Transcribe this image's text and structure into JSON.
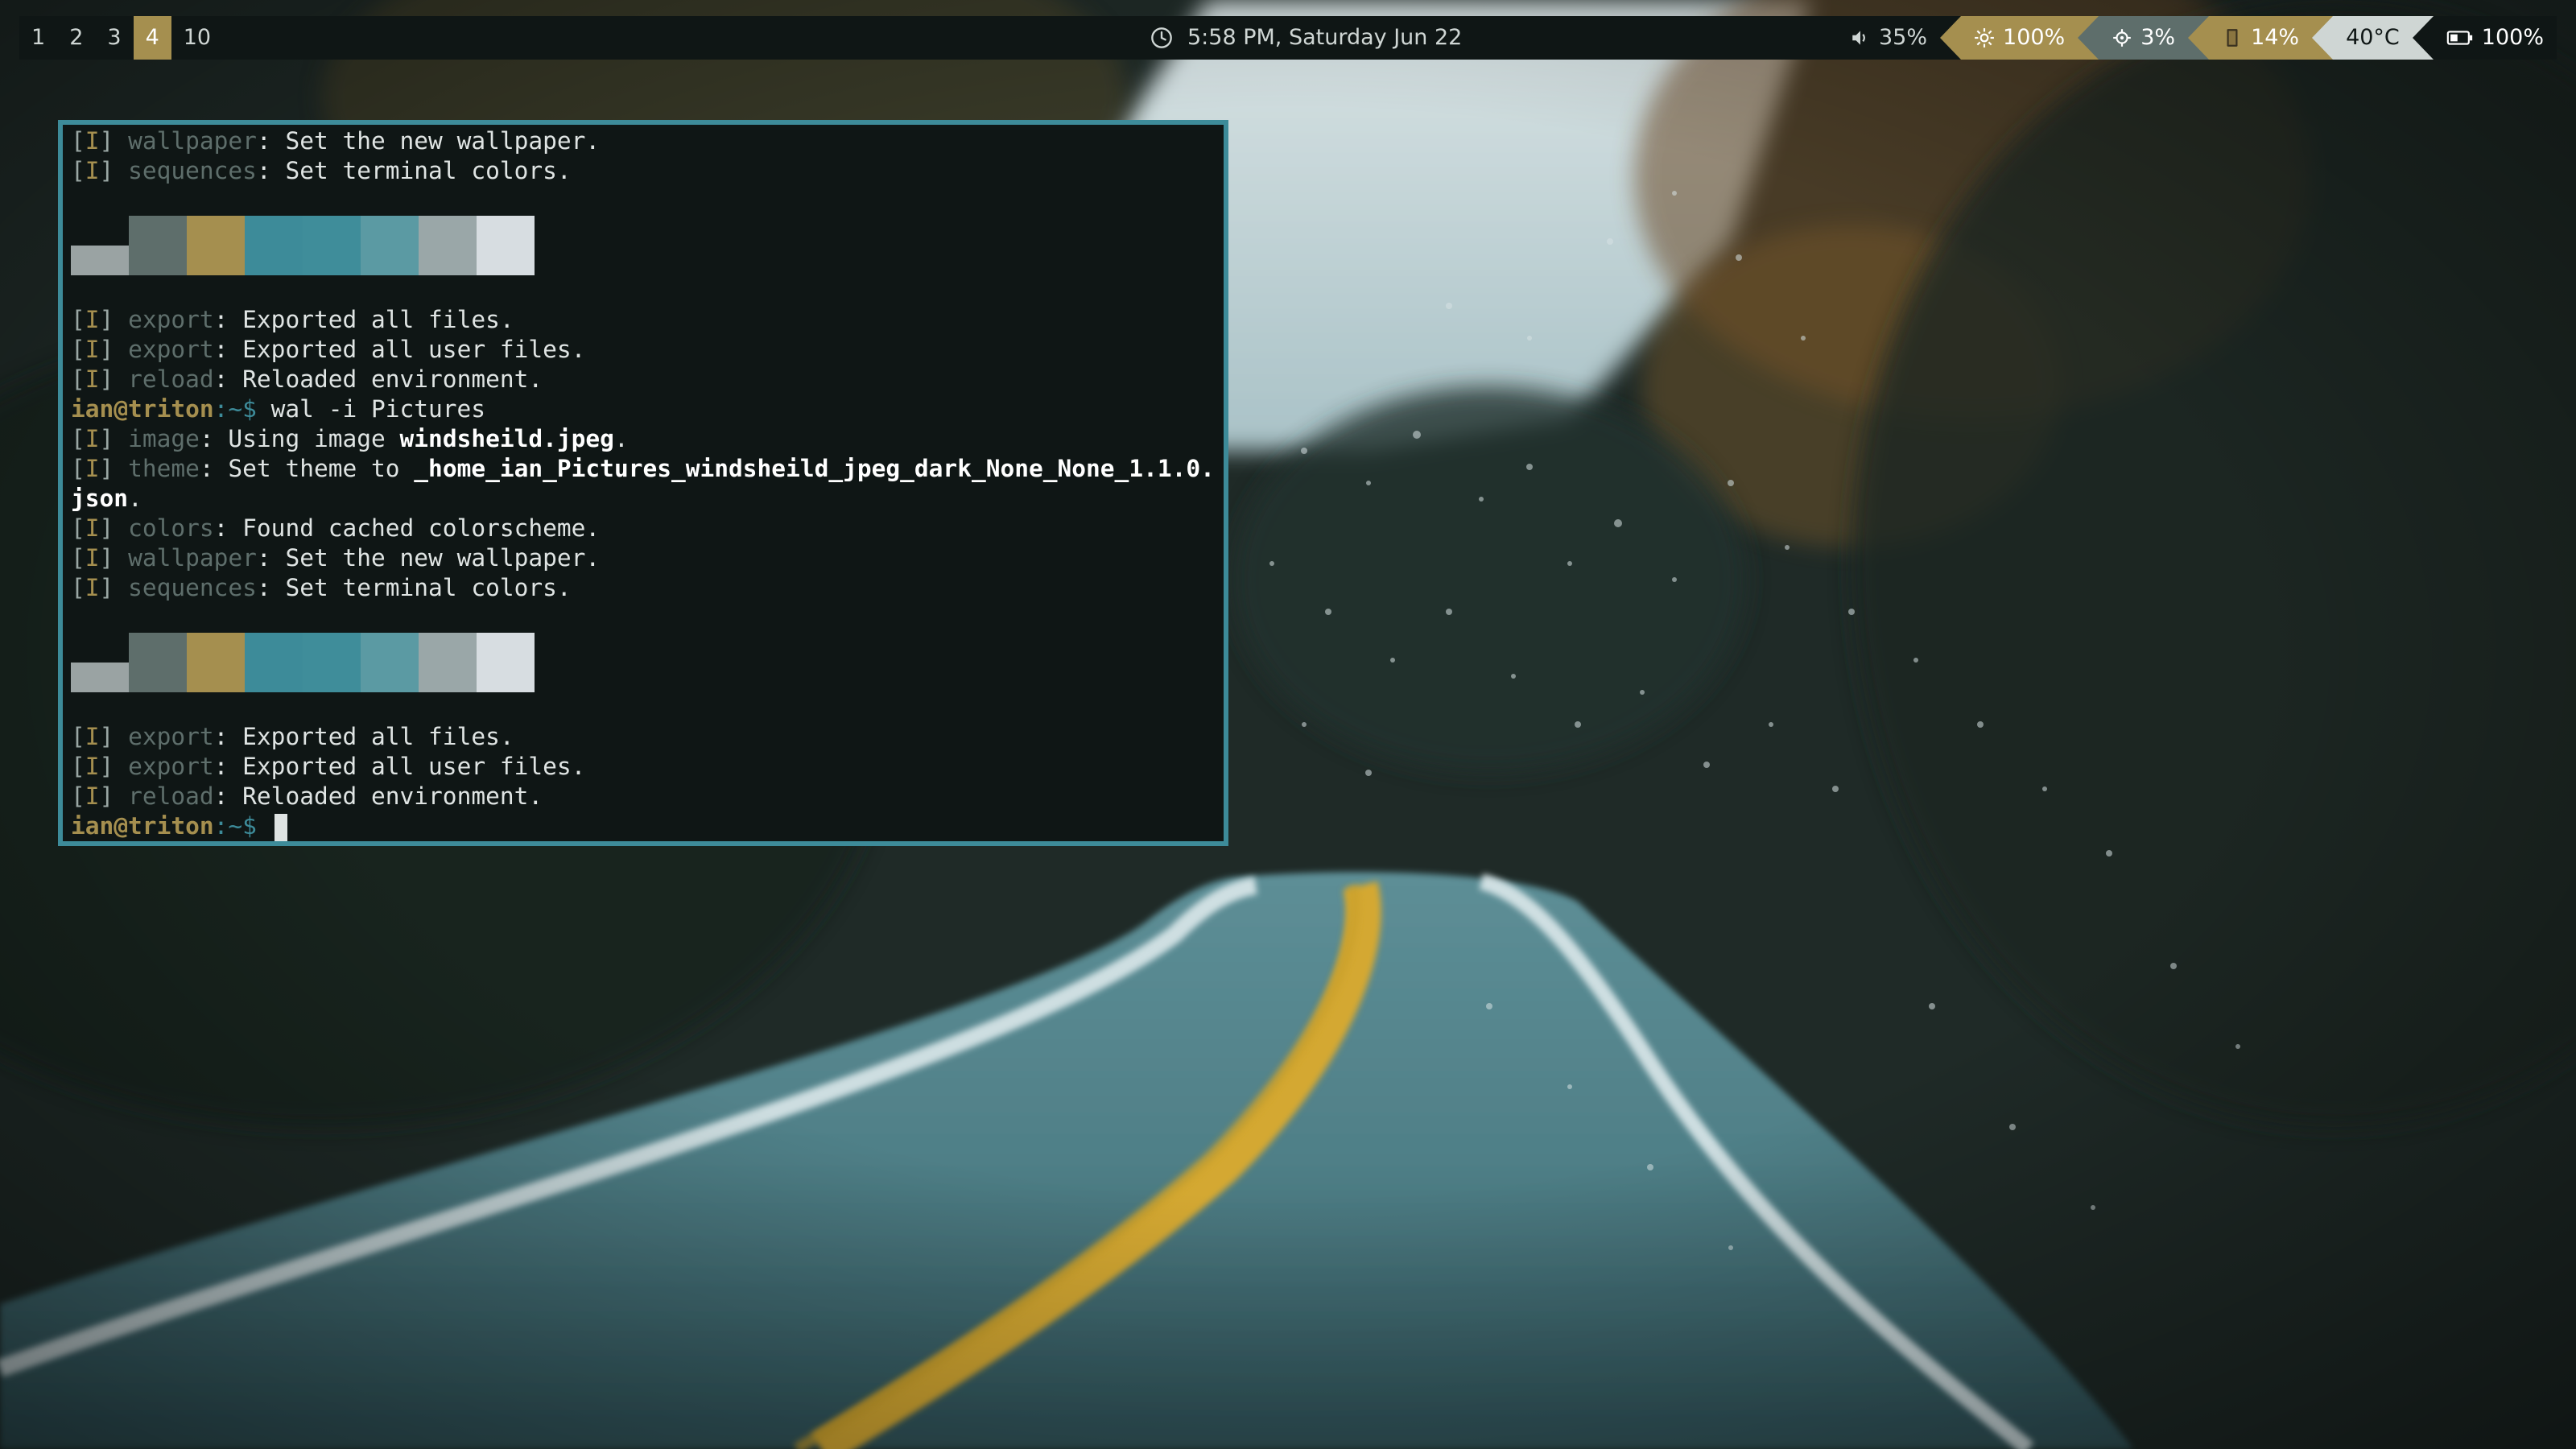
{
  "bar": {
    "workspaces": [
      {
        "label": "1",
        "active": false
      },
      {
        "label": "2",
        "active": false
      },
      {
        "label": "3",
        "active": false
      },
      {
        "label": "4",
        "active": true
      },
      {
        "label": "10",
        "active": false
      }
    ],
    "clock": "5:58 PM, Saturday Jun 22",
    "modules": {
      "volume": "35%",
      "brightness": "100%",
      "cpu": "3%",
      "memory": "14%",
      "temperature": "40°C",
      "battery": "100%"
    },
    "colors": {
      "bar_bg": "#0f1615",
      "accent_gold": "#a58f4f",
      "accent_grey": "#5e6e6b",
      "light": "#cfd6d4"
    }
  },
  "terminal": {
    "border_color": "#3d8b99",
    "lines": {
      "l1_mod": "wallpaper",
      "l1_text": ": Set the new wallpaper.",
      "l2_mod": "sequences",
      "l2_text": ": Set terminal colors.",
      "l3_mod": "export",
      "l3_text": ": Exported all files.",
      "l4_mod": "export",
      "l4_text": ": Exported all user files.",
      "l5_mod": "reload",
      "l5_text": ": Reloaded environment.",
      "prompt_user": "ian@triton",
      "prompt_path": ":~$ ",
      "command": "wal -i Pictures",
      "l6_mod": "image",
      "l6_text": ": Using image ",
      "l6_bold": "windsheild.jpeg",
      "l6_end": ".",
      "l7_mod": "theme",
      "l7_text": ": Set theme to ",
      "l7_bold": "_home_ian_Pictures_windsheild_jpeg_dark_None_None_1.1.0.",
      "l7b_bold": "json",
      "l7b_end": ".",
      "l8_mod": "colors",
      "l8_text": ": Found cached colorscheme.",
      "l9_mod": "wallpaper",
      "l9_text": ": Set the new wallpaper.",
      "l10_mod": "sequences",
      "l10_text": ": Set terminal colors.",
      "l11_mod": "export",
      "l11_text": ": Exported all files.",
      "l12_mod": "export",
      "l12_text": ": Exported all user files.",
      "l13_mod": "reload",
      "l13_text": ": Reloaded environment.",
      "tag_open": "[",
      "tag_i": "I",
      "tag_close": "] "
    },
    "palette_colors": [
      "#9aa3a3",
      "#5e6e6b",
      "#a58f4f",
      "#3d8b99",
      "#3f8d9a",
      "#5b9aa3",
      "#9aa7a8",
      "#d7dde1"
    ]
  }
}
